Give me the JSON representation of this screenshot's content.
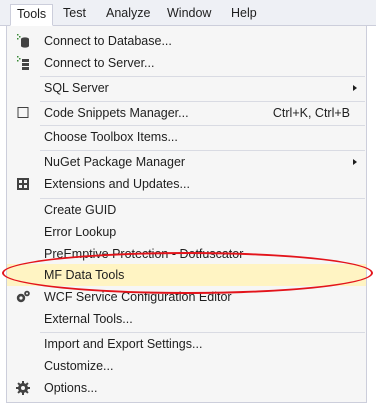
{
  "menubar": {
    "items": [
      {
        "label": "Tools"
      },
      {
        "label": "Test"
      },
      {
        "label": "Analyze"
      },
      {
        "label": "Window"
      },
      {
        "label": "Help"
      }
    ]
  },
  "menu": {
    "items": [
      {
        "label": "Connect to Database...",
        "icon": "database-connect-icon"
      },
      {
        "label": "Connect to Server...",
        "icon": "server-connect-icon"
      },
      {
        "label": "SQL Server",
        "submenu": true
      },
      {
        "label": "Code Snippets Manager...",
        "shortcut": "Ctrl+K, Ctrl+B",
        "icon": "checkbox-icon"
      },
      {
        "label": "Choose Toolbox Items..."
      },
      {
        "label": "NuGet Package Manager",
        "submenu": true
      },
      {
        "label": "Extensions and Updates...",
        "icon": "extensions-icon"
      },
      {
        "label": "Create GUID"
      },
      {
        "label": "Error Lookup"
      },
      {
        "label": "PreEmptive Protection - Dotfuscator"
      },
      {
        "label": "MF Data Tools"
      },
      {
        "label": "WCF Service Configuration Editor",
        "icon": "gears-icon"
      },
      {
        "label": "External Tools..."
      },
      {
        "label": "Import and Export Settings..."
      },
      {
        "label": "Customize..."
      },
      {
        "label": "Options...",
        "icon": "gear-icon"
      }
    ]
  },
  "colors": {
    "highlight": "#fff4c3",
    "annotation": "#e3141b",
    "menu_background": "#f6f6f6"
  }
}
